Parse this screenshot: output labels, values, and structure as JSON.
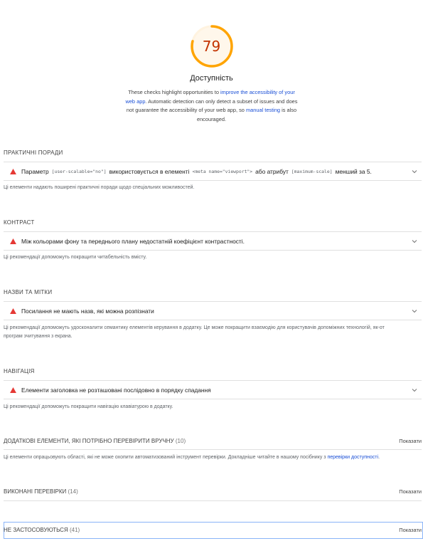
{
  "score": {
    "value": "79",
    "fraction": 0.79,
    "color": "#ffa400",
    "text_color": "#c33300"
  },
  "category": {
    "title": "Доступність",
    "desc_1": "These checks highlight opportunities to ",
    "desc_link_1": "improve the accessibility of your web app",
    "desc_2": ". Automatic detection can only detect a subset of issues and does not guarantee the accessibility of your web app, so ",
    "desc_link_2": "manual testing",
    "desc_3": " is also encouraged."
  },
  "groups": {
    "best_practices": {
      "title": "ПРАКТИЧНІ ПОРАДИ",
      "audit_1": "Параметр",
      "audit_code_1": "[user-scalable=\"no\"]",
      "audit_2": "використовується в елементі",
      "audit_code_2": "<meta name=\"viewport\">",
      "audit_3": "або атрибут",
      "audit_code_3": "[maximum-scale]",
      "audit_4": "менший за 5.",
      "description": "Ці елементи надають поширені практичні поради щодо спеціальних можливостей."
    },
    "contrast": {
      "title": "КОНТРАСТ",
      "audit": "Між кольорами фону та переднього плану недостатній коефіцієнт контрастності.",
      "description": "Ці рекомендації допоможуть покращити читабельність вмісту."
    },
    "names_labels": {
      "title": "НАЗВИ ТА МІТКИ",
      "audit": "Посилання не мають назв, які можна розпізнати",
      "description_1": "Ці рекомендації допоможуть удосконалити семантику елементів керування в додатку. Це може покращити взаємодію для користувачів допоміжних технологій, як-от",
      "description_2": "програм зчитування з екрана."
    },
    "navigation": {
      "title": "НАВІГАЦІЯ",
      "audit": "Елементи заголовка не розташовані послідовно в порядку спадання",
      "description": "Ці рекомендації допоможуть покращити навігацію клавіатурою в додатку."
    }
  },
  "manual": {
    "title": "ДОДАТКОВІ ЕЛЕМЕНТИ, ЯКІ ПОТРІБНО ПЕРЕВІРИТИ ВРУЧНУ",
    "count": "(10)",
    "show": "Показати",
    "description": "Ці елементи опрацьовують області, які не може охопити автоматизований інструмент перевірки. Докладніше читайте в нашому посібнику з ",
    "link": "перевірки доступності",
    "description_end": "."
  },
  "passed": {
    "title": "ВИКОНАНІ ПЕРЕВІРКИ",
    "count": "(14)",
    "show": "Показати"
  },
  "not_applicable": {
    "title": "НЕ ЗАСТОСОВУЮТЬСЯ",
    "count": "(41)",
    "show": "Показати"
  },
  "colors": {
    "warn": "#e53935",
    "link": "#1a4fd6"
  }
}
